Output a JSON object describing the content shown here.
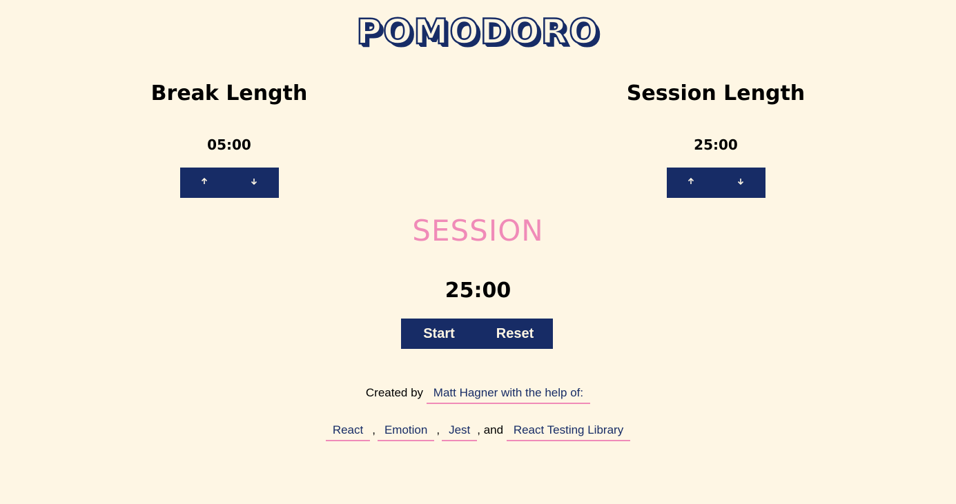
{
  "app": {
    "logo_text": "POMODORO"
  },
  "break_panel": {
    "title": "Break Length",
    "value": "05:00",
    "increment_icon": "arrow-up-icon",
    "decrement_icon": "arrow-down-icon"
  },
  "session_panel": {
    "title": "Session Length",
    "value": "25:00",
    "increment_icon": "arrow-up-icon",
    "decrement_icon": "arrow-down-icon"
  },
  "timer": {
    "label": "SESSION",
    "value": "25:00",
    "start_label": "Start",
    "reset_label": "Reset"
  },
  "footer": {
    "created_by_text": "Created by",
    "author_link": "Matt Hagner with the help of:",
    "tools": [
      "React",
      "Emotion",
      "Jest",
      "React Testing Library"
    ],
    "separator": ",",
    "and_text": ", and"
  },
  "colors": {
    "background": "#fef6e4",
    "primary": "#172c66",
    "accent": "#f08bb8",
    "text": "#000000"
  }
}
